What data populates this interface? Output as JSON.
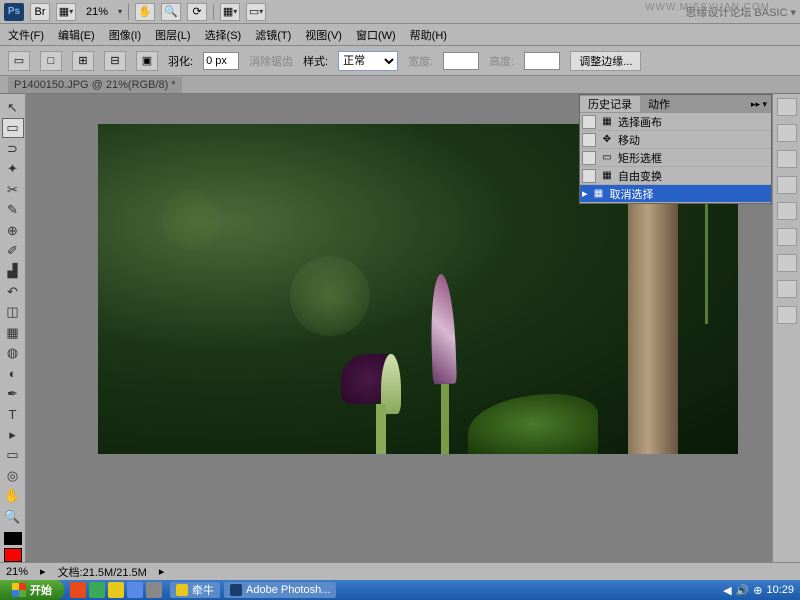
{
  "watermark": "WWW.MISSYUAN.COM",
  "top": {
    "zoom": "21%",
    "brand": "思缘设计论坛 BASIC ▾"
  },
  "menu": {
    "file": "文件(F)",
    "edit": "编辑(E)",
    "image": "图像(I)",
    "layer": "图层(L)",
    "select": "选择(S)",
    "filter": "滤镜(T)",
    "view": "视图(V)",
    "window": "窗口(W)",
    "help": "帮助(H)"
  },
  "options": {
    "feather_lbl": "羽化:",
    "feather_val": "0 px",
    "antialias": "消除锯齿",
    "style_lbl": "样式:",
    "style_val": "正常",
    "width_lbl": "宽度:",
    "height_lbl": "高度:",
    "refine": "调整边缘..."
  },
  "doc": {
    "tab": "P1400150.JPG @ 21%(RGB/8) *"
  },
  "history": {
    "tab1": "历史记录",
    "tab2": "动作",
    "more": "▸▸ ▾",
    "items": [
      {
        "icon": "▦",
        "label": "选择画布"
      },
      {
        "icon": "✥",
        "label": "移动"
      },
      {
        "icon": "▭",
        "label": "矩形选框"
      },
      {
        "icon": "▦",
        "label": "自由变换"
      },
      {
        "icon": "▦",
        "label": "取消选择"
      }
    ]
  },
  "status": {
    "zoom": "21%",
    "doc": "文档:21.5M/21.5M"
  },
  "taskbar": {
    "start": "开始",
    "task1": "牵牛",
    "task2": "Adobe Photosh...",
    "time": "10:29"
  },
  "colors": {
    "fg": "#000000",
    "accent": "#ff0000"
  }
}
